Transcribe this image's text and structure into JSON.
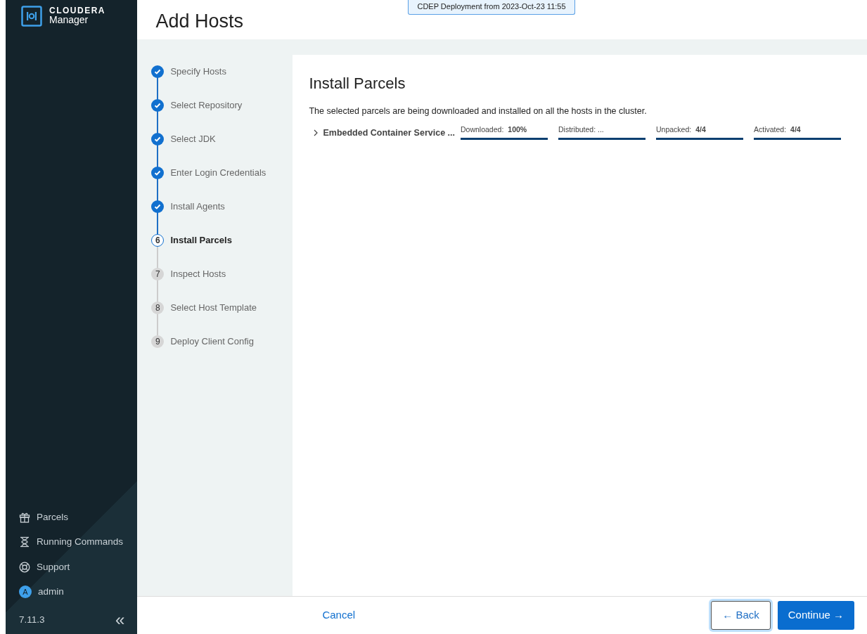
{
  "brand": {
    "name": "CLOUDERA",
    "product": "Manager"
  },
  "sidebar": {
    "items": [
      {
        "kind": "parcels",
        "label": "Parcels"
      },
      {
        "kind": "commands",
        "label": "Running Commands"
      },
      {
        "kind": "support",
        "label": "Support"
      },
      {
        "kind": "user",
        "label": "admin",
        "avatar": "A"
      }
    ],
    "version": "7.11.3",
    "collapse": "«"
  },
  "banner": "CDEP Deployment from 2023-Oct-23 11:55",
  "page_title": "Add Hosts",
  "steps": [
    {
      "label": "Specify Hosts",
      "done": true,
      "selected": false
    },
    {
      "label": "Select Repository",
      "done": true,
      "selected": false
    },
    {
      "label": "Select JDK",
      "done": true,
      "selected": false
    },
    {
      "label": "Enter Login Credentials",
      "done": true,
      "selected": false
    },
    {
      "label": "Install Agents",
      "done": true,
      "selected": false
    },
    {
      "label": "Install Parcels",
      "number": "6",
      "done": false,
      "selected": true
    },
    {
      "label": "Inspect Hosts",
      "number": "7",
      "done": false,
      "selected": false
    },
    {
      "label": "Select Host Template",
      "number": "8",
      "done": false,
      "selected": false
    },
    {
      "label": "Deploy Client Config",
      "number": "9",
      "done": false,
      "selected": false
    }
  ],
  "section": {
    "title": "Install Parcels",
    "description": "The selected parcels are being downloaded and installed on all the hosts in the cluster.",
    "parcels": [
      {
        "name": "Embedded Container Service ...",
        "expanded": false,
        "stages": [
          {
            "label": "Downloaded:",
            "value": "100%",
            "level": 1
          },
          {
            "label": "Distributed: ...",
            "level": 1
          },
          {
            "label": "Unpacked:",
            "value": "4/4",
            "level": 1
          },
          {
            "label": "Activated:",
            "value": "4/4",
            "level": 1
          }
        ]
      }
    ]
  },
  "footer": {
    "cancel": "Cancel",
    "back": "← Back",
    "continue": "Continue →"
  }
}
